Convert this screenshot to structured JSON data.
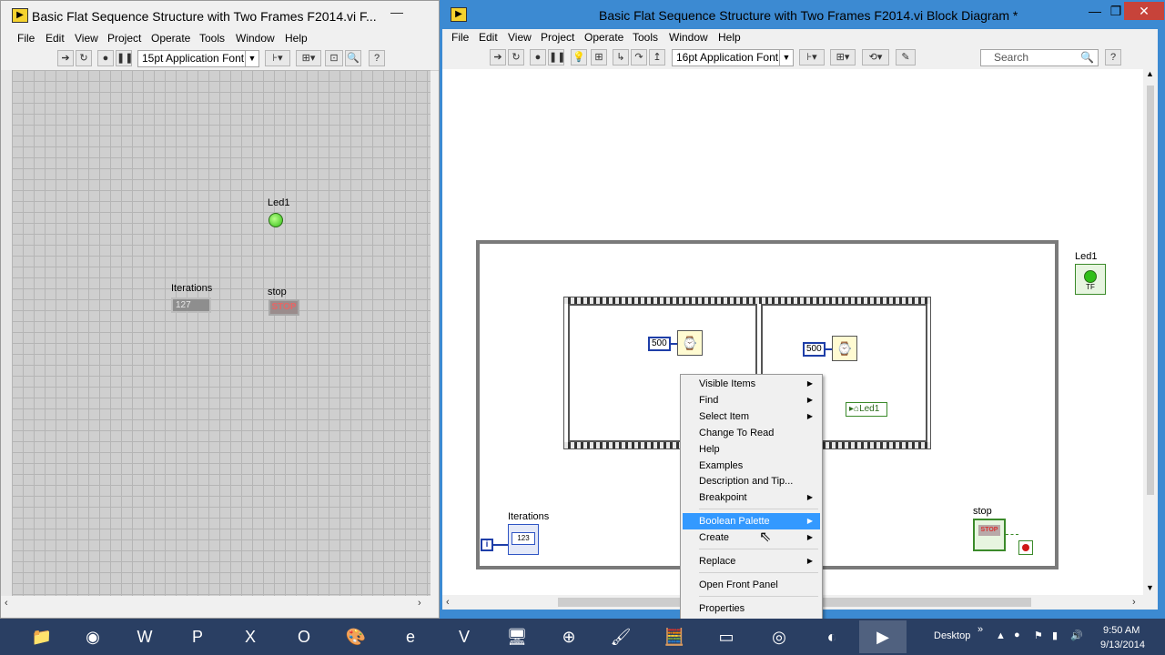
{
  "front_panel": {
    "title": "Basic Flat Sequence Structure with Two Frames F2014.vi F...",
    "menu": [
      "File",
      "Edit",
      "View",
      "Project",
      "Operate",
      "Tools",
      "Window",
      "Help"
    ],
    "font_label": "15pt Application Font",
    "controls": {
      "led_label": "Led1",
      "iterations_label": "Iterations",
      "iterations_value": "127",
      "stop_label": "stop",
      "stop_text": "STOP"
    }
  },
  "block_diagram": {
    "title": "Basic Flat Sequence Structure with Two Frames F2014.vi Block Diagram *",
    "menu": [
      "File",
      "Edit",
      "View",
      "Project",
      "Operate",
      "Tools",
      "Window",
      "Help"
    ],
    "font_label": "16pt Application Font",
    "search_placeholder": "Search",
    "nodes": {
      "led_label": "Led1",
      "iterations_label": "Iterations",
      "stop_label": "stop",
      "wait1_const": "500",
      "wait2_const": "500",
      "local_var": "Led1",
      "iteration_terminal": "i",
      "numeric_terminal_text": "123",
      "bool_terminal_text": "TF",
      "stop_terminal_text": "STOP"
    },
    "context_menu": [
      {
        "label": "Visible Items",
        "submenu": true
      },
      {
        "label": "Find",
        "submenu": true
      },
      {
        "label": "Select Item",
        "submenu": true
      },
      {
        "label": "Change To Read",
        "submenu": false
      },
      {
        "label": "Help",
        "submenu": false
      },
      {
        "label": "Examples",
        "submenu": false
      },
      {
        "label": "Description and Tip...",
        "submenu": false
      },
      {
        "label": "Breakpoint",
        "submenu": true
      },
      {
        "label": "Boolean Palette",
        "submenu": true,
        "highlighted": true
      },
      {
        "label": "Create",
        "submenu": true
      },
      {
        "label": "Replace",
        "submenu": true
      },
      {
        "label": "Open Front Panel",
        "submenu": false
      },
      {
        "label": "Properties",
        "submenu": false
      }
    ]
  },
  "taskbar": {
    "desktop_label": "Desktop",
    "time": "9:50 AM",
    "date": "9/13/2014"
  }
}
